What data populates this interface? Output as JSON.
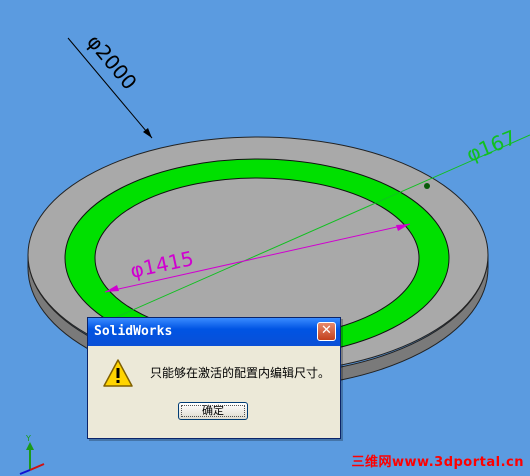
{
  "colors": {
    "background": "#5b9be0",
    "plate": "#a9a9a9",
    "ring": "#00e000",
    "dimension_black": "#000000",
    "dimension_magenta": "#d000d0",
    "dimension_green": "#10c020",
    "arrow_red": "#ff0000"
  },
  "dimensions": {
    "outer_diameter": "φ2000",
    "inner_diameter": "φ1415",
    "ring_diameter": "φ167"
  },
  "dialog": {
    "title": "SolidWorks",
    "close_glyph": "✕",
    "message": "只能够在激活的配置内编辑尺寸。",
    "ok_label": "确定",
    "icon": "warning-icon"
  },
  "axes": {
    "y_label": "Y",
    "icon": "axis-triad-icon"
  },
  "watermark": "三维网www.3dportal.cn"
}
